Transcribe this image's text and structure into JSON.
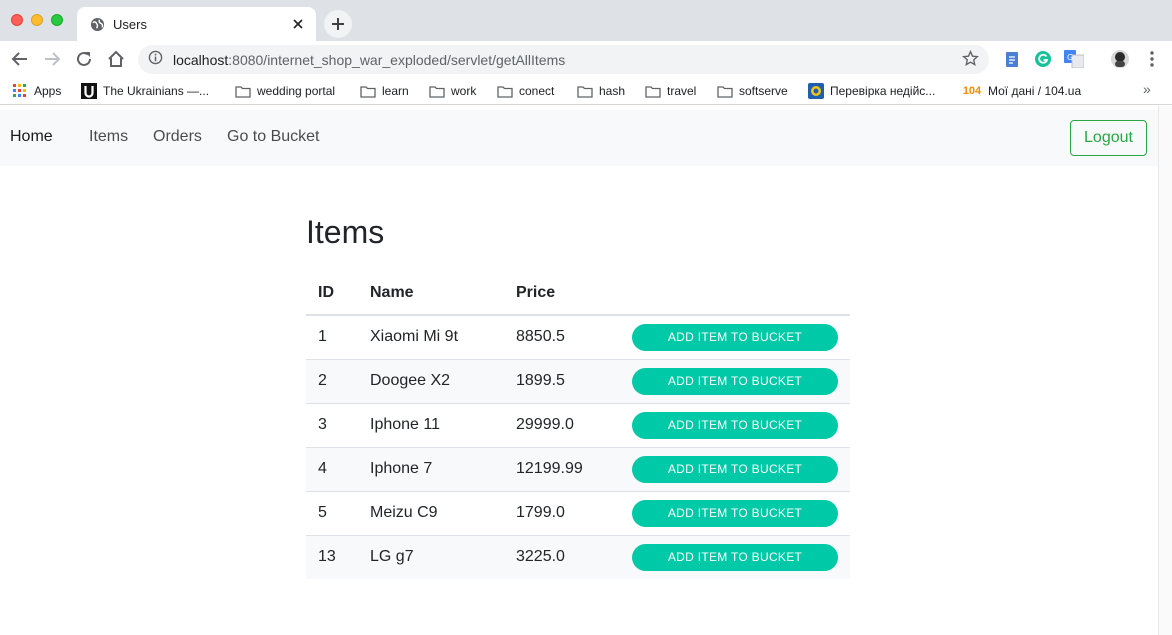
{
  "browser": {
    "tab_title": "Users",
    "url_host": "localhost",
    "url_rest": ":8080/internet_shop_war_exploded/servlet/getAllItems",
    "bookmarks": [
      {
        "label": "Apps",
        "icon": "apps-grid-icon"
      },
      {
        "label": "The Ukrainians —...",
        "icon": "u-logo-icon"
      },
      {
        "label": "wedding portal",
        "icon": "folder-icon"
      },
      {
        "label": "learn",
        "icon": "folder-icon"
      },
      {
        "label": "work",
        "icon": "folder-icon"
      },
      {
        "label": "conect",
        "icon": "folder-icon"
      },
      {
        "label": "hash",
        "icon": "folder-icon"
      },
      {
        "label": "travel",
        "icon": "folder-icon"
      },
      {
        "label": "softserve",
        "icon": "folder-icon"
      },
      {
        "label": "Перевірка недійс...",
        "icon": "globe-badge-icon"
      },
      {
        "label": "Мої дані / 104.ua",
        "icon": "104-icon",
        "icon_text": "104"
      }
    ]
  },
  "navbar": {
    "brand": "Home",
    "links": [
      "Items",
      "Orders",
      "Go to Bucket"
    ],
    "logout": "Logout"
  },
  "page": {
    "title": "Items",
    "columns": [
      "ID",
      "Name",
      "Price",
      ""
    ],
    "rows": [
      {
        "id": "1",
        "name": "Xiaomi Mi 9t",
        "price": "8850.5"
      },
      {
        "id": "2",
        "name": "Doogee X2",
        "price": "1899.5"
      },
      {
        "id": "3",
        "name": "Iphone 11",
        "price": "29999.0"
      },
      {
        "id": "4",
        "name": "Iphone 7",
        "price": "12199.99"
      },
      {
        "id": "5",
        "name": "Meizu C9",
        "price": "1799.0"
      },
      {
        "id": "13",
        "name": "LG g7",
        "price": "3225.0"
      }
    ],
    "add_button_label": "ADD ITEM TO BUCKET"
  },
  "colors": {
    "accent_button": "#00c9a7",
    "logout_green": "#28a745",
    "navbar_bg": "#f8f9fa"
  }
}
